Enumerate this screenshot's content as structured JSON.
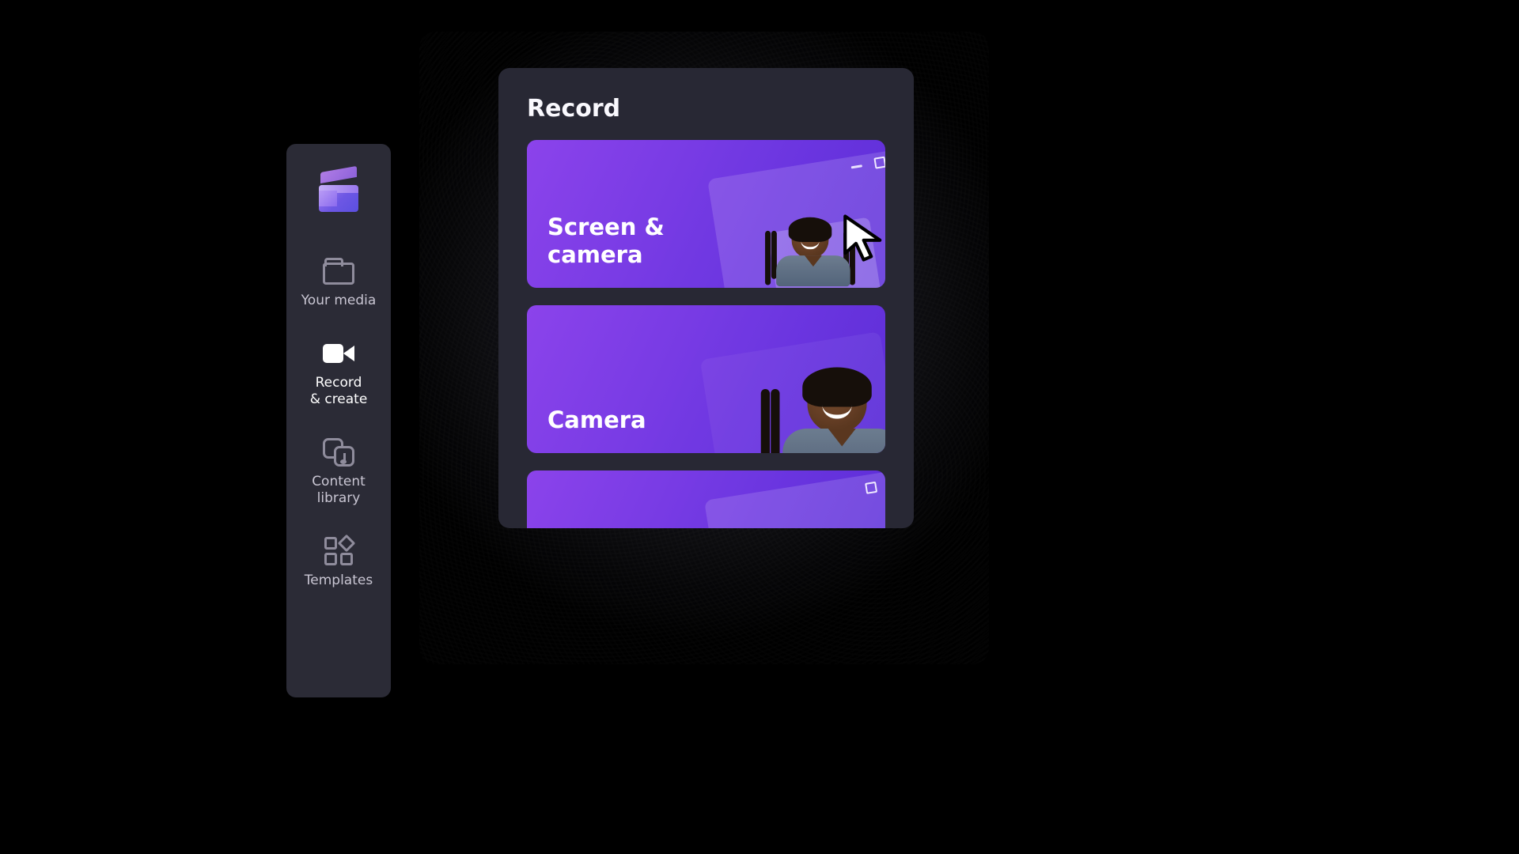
{
  "sidebar": {
    "items": [
      {
        "icon": "clapperboard-logo",
        "label": ""
      },
      {
        "icon": "folder-icon",
        "label": "Your media"
      },
      {
        "icon": "video-camera-icon",
        "label": "Record\n& create"
      },
      {
        "icon": "content-library-icon",
        "label": "Content\nlibrary"
      },
      {
        "icon": "templates-icon",
        "label": "Templates"
      }
    ],
    "active_index": 2
  },
  "panel": {
    "title": "Record",
    "cards": [
      {
        "label": "Screen &\ncamera",
        "kind": "screen-camera"
      },
      {
        "label": "Camera",
        "kind": "camera"
      },
      {
        "label": "",
        "kind": "screen"
      }
    ]
  },
  "colors": {
    "card_gradient_from": "#8b46e6",
    "card_gradient_to": "#5e32d4",
    "sidebar_bg": "#2b2b36",
    "panel_bg": "#2c2c38"
  },
  "icons": {
    "cursor": "pointer-arrow-icon"
  }
}
